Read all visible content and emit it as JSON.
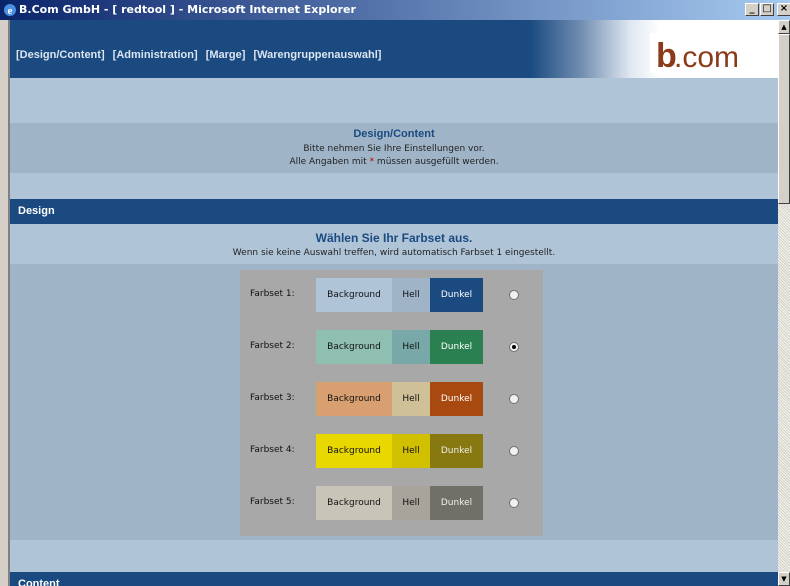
{
  "window": {
    "title": "B.Com GmbH - [ redtool ] - Microsoft Internet Explorer",
    "minimize": "_",
    "maximize": "□",
    "close": "×"
  },
  "nav": {
    "items": [
      "[Design/Content]",
      "[Administration]",
      "[Marge]",
      "[Warengruppenauswahl]"
    ]
  },
  "logo": {
    "bold": "b",
    "rest": ".com"
  },
  "intro": {
    "title": "Design/Content",
    "line1": "Bitte nehmen Sie Ihre Einstellungen vor.",
    "line2_before": "Alle Angaben mit ",
    "line2_star": "*",
    "line2_after": " müssen ausgefüllt werden."
  },
  "sections": {
    "design": "Design",
    "content": "Content"
  },
  "farbset": {
    "title": "Wählen Sie Ihr Farbset aus.",
    "subtitle": "Wenn sie keine Auswahl treffen, wird automatisch Farbset 1 eingestellt.",
    "swatch_labels": {
      "background": "Background",
      "hell": "Hell",
      "dunkel": "Dunkel"
    },
    "sets": [
      {
        "label": "Farbset 1:",
        "background": "#b0c4d8",
        "hell": "#a0b4c8",
        "dunkel": "#1a4a80",
        "selected": false
      },
      {
        "label": "Farbset 2:",
        "background": "#8fbfb0",
        "hell": "#78a8a8",
        "dunkel": "#2a8050",
        "selected": true
      },
      {
        "label": "Farbset 3:",
        "background": "#d8a070",
        "hell": "#d0c098",
        "dunkel": "#a84a10",
        "selected": false
      },
      {
        "label": "Farbset 4:",
        "background": "#e8d800",
        "hell": "#d0c000",
        "dunkel": "#887810",
        "selected": false
      },
      {
        "label": "Farbset 5:",
        "background": "#c8c4b8",
        "hell": "#a8a49c",
        "dunkel": "#707068",
        "selected": false
      }
    ]
  },
  "colors": {
    "brand": "#1a4a80",
    "logo": "#8b3a1a",
    "page_bg": "#b0c4d8",
    "band_bg": "#a0b4c8"
  }
}
